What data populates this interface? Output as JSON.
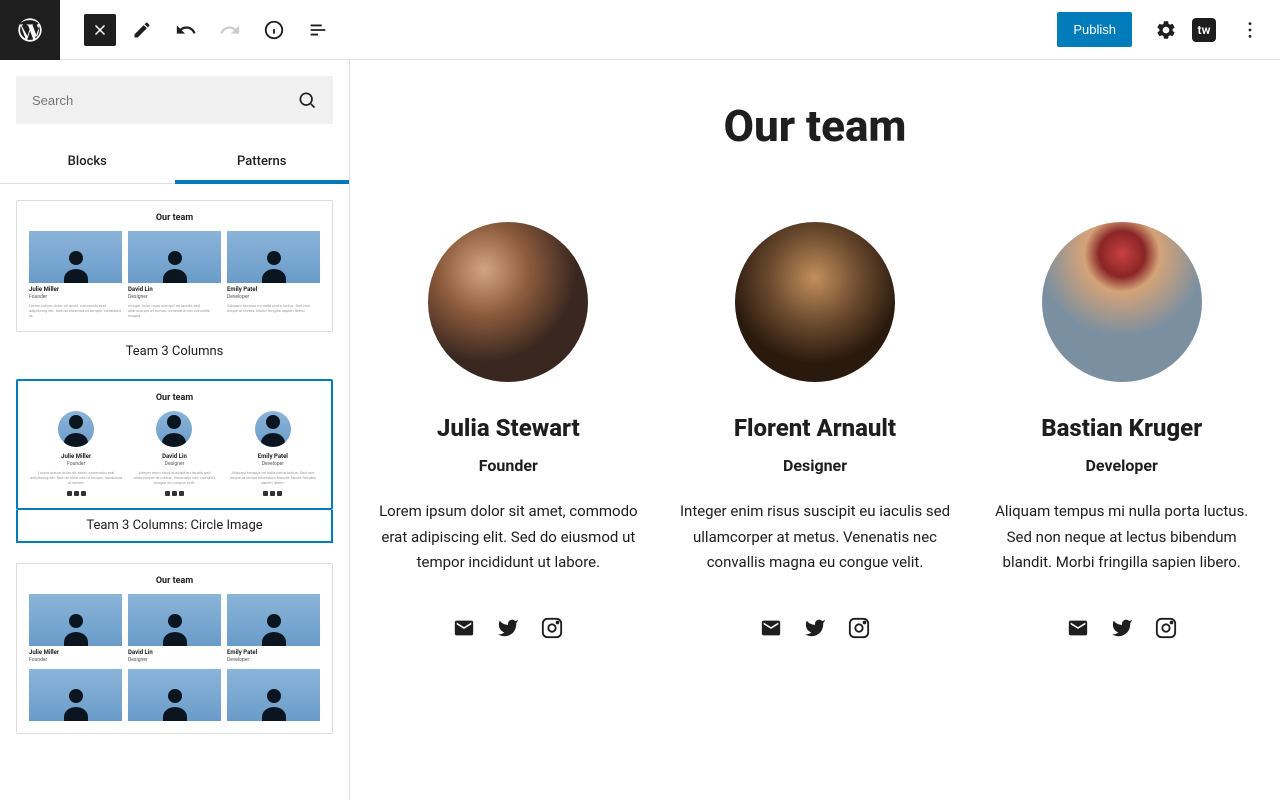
{
  "topbar": {
    "publish_label": "Publish",
    "tw_label": "tw"
  },
  "sidebar": {
    "search_placeholder": "Search",
    "tabs": {
      "blocks": "Blocks",
      "patterns": "Patterns"
    },
    "patterns": [
      {
        "title": "Our team",
        "label": "Team 3 Columns",
        "cols": [
          {
            "name": "Julie Miller",
            "role": "Founder",
            "desc": "Lorem ipsum dolor sit amet, commodo erat adipiscing elit. Sed do eiusmod ut tempor incididunt ut."
          },
          {
            "name": "David Lin",
            "role": "Designer",
            "desc": "Integer enim risus suscipit eu iaculis sed ullamcorper at metus. Venenatis nec convallis magna."
          },
          {
            "name": "Emily Patel",
            "role": "Developer",
            "desc": "Aliquam tempus mi nulla porta luctus. Sed non neque at lectus. Morbi fringilla sapien libero."
          }
        ]
      },
      {
        "title": "Our team",
        "label": "Team 3 Columns: Circle Image",
        "cols": [
          {
            "name": "Julie Miller",
            "role": "Founder",
            "desc": "Lorem ipsum dolor sit amet, commodo erat adipiscing elit. Sed do eiusmod ut tempor incididunt ut labore."
          },
          {
            "name": "David Lin",
            "role": "Designer",
            "desc": "Integer enim risus suscipit eu iaculis sed ullamcorper at metus. Venenatis nec convallis magna eu congue velit."
          },
          {
            "name": "Emily Patel",
            "role": "Developer",
            "desc": "Aliquam tempus mi nulla porta luctus. Sed non neque at lectus bibendum blandit. Morbi fringilla sapien libero."
          }
        ]
      },
      {
        "title": "Our team",
        "label": "",
        "cols": [
          {
            "name": "Julie Miller",
            "role": "Founder"
          },
          {
            "name": "David Lin",
            "role": "Designer"
          },
          {
            "name": "Emily Patel",
            "role": "Developer"
          }
        ]
      }
    ]
  },
  "canvas": {
    "title": "Our team",
    "members": [
      {
        "name": "Julia Stewart",
        "role": "Founder",
        "bio": "Lorem ipsum dolor sit amet, commodo erat adipiscing elit. Sed do eiusmod ut tempor incididunt ut labore."
      },
      {
        "name": "Florent Arnault",
        "role": "Designer",
        "bio": "Integer enim risus suscipit eu iaculis sed ullamcorper at metus. Venenatis nec convallis magna eu congue velit."
      },
      {
        "name": "Bastian Kruger",
        "role": "Developer",
        "bio": "Aliquam tempus mi nulla porta luctus. Sed non neque at lectus bibendum blandit. Morbi fringilla sapien libero."
      }
    ]
  }
}
